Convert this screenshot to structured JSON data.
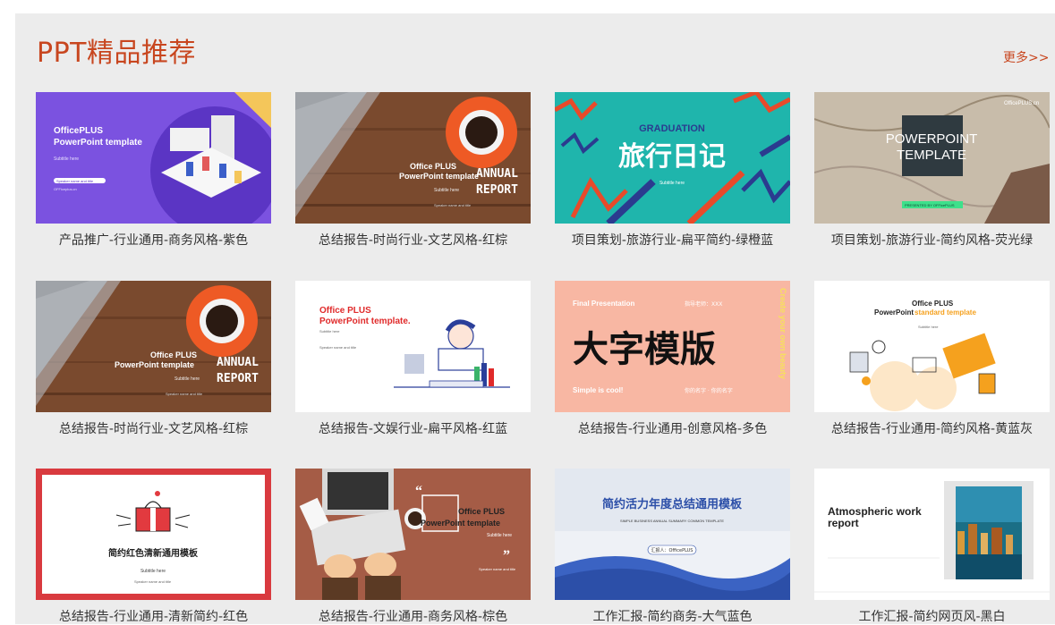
{
  "section": {
    "title": "PPT精品推荐",
    "more": "更多>>"
  },
  "cards": [
    {
      "caption": "产品推广-行业通用-商务风格-紫色",
      "t1": "OfficePLUS",
      "t2": "PowerPoint template",
      "t3": "Subtitle here",
      "t4": "Speaker name and title",
      "t5": "OFFiceplus.cn"
    },
    {
      "caption": "总结报告-时尚行业-文艺风格-红棕",
      "t1": "Office PLUS",
      "t2": "PowerPoint template",
      "t3": "ANNUAL",
      "t4": "REPORT",
      "t5": "Subtitle here",
      "t6": "Speaker name and title"
    },
    {
      "caption": "项目策划-旅游行业-扁平简约-绿橙蓝",
      "t1": "GRADUATION",
      "t2": "旅行日记",
      "t3": "Subtitle here"
    },
    {
      "caption": "项目策划-旅游行业-简约风格-荧光绿",
      "t1": "OfficePLUS.cn",
      "t2": "POWERPOINT",
      "t3": "TEMPLATE",
      "t4": "PRESENTED BY OFFicePLUS"
    },
    {
      "caption": "总结报告-时尚行业-文艺风格-红棕",
      "t1": "Office PLUS",
      "t2": "PowerPoint template",
      "t3": "ANNUAL",
      "t4": "REPORT",
      "t5": "Subtitle here",
      "t6": "Speaker name and title"
    },
    {
      "caption": "总结报告-文娱行业-扁平风格-红蓝",
      "t1": "Office PLUS",
      "t2": "PowerPoint template.",
      "t3": "Subtitle here",
      "t4": "Speaker name and title"
    },
    {
      "caption": "总结报告-行业通用-创意风格-多色",
      "t1": "Final Presentation",
      "t2": "指导老师：XXX",
      "t3": "大字模版",
      "t4": "Simple is cool!",
      "t5": "你的名字 · 你的名字",
      "t6": "Create your own beauty"
    },
    {
      "caption": "总结报告-行业通用-简约风格-黄蓝灰",
      "t1": "Office PLUS",
      "t2": "PowerPoint",
      "t3": "standard template",
      "t4": "Subtitle here"
    },
    {
      "caption": "总结报告-行业通用-清新简约-红色",
      "t1": "简约红色清新通用模板",
      "t2": "Subtitle here",
      "t3": "Speaker name and title"
    },
    {
      "caption": "总结报告-行业通用-商务风格-棕色",
      "t1": "Office PLUS",
      "t2": "PowerPoint template",
      "t3": "Subtitle here",
      "t4": "Speaker name and title"
    },
    {
      "caption": "工作汇报-简约商务-大气蓝色",
      "t1": "简约活力年度总结通用模板",
      "t2": "SIMPLE BUSINESS ANNUAL SUMMARY COMMON TEMPLATE",
      "t3": "汇报人：OfficePLUS"
    },
    {
      "caption": "工作汇报-简约网页风-黑白",
      "t1": "Atmospheric work",
      "t2": "report"
    }
  ]
}
